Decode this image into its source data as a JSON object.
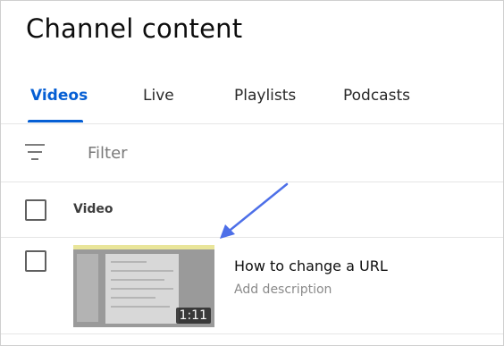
{
  "page": {
    "title": "Channel content"
  },
  "tabs": [
    {
      "label": "Videos",
      "active": true
    },
    {
      "label": "Live",
      "active": false
    },
    {
      "label": "Playlists",
      "active": false
    },
    {
      "label": "Podcasts",
      "active": false
    }
  ],
  "filter": {
    "label": "Filter",
    "icon": "filter-icon"
  },
  "table": {
    "column_video": "Video"
  },
  "videos": [
    {
      "title": "How to change a URL",
      "description": "Add description",
      "duration": "1:11"
    }
  ],
  "colors": {
    "accent": "#065fd4",
    "annotation_arrow": "#4d6fe8"
  }
}
